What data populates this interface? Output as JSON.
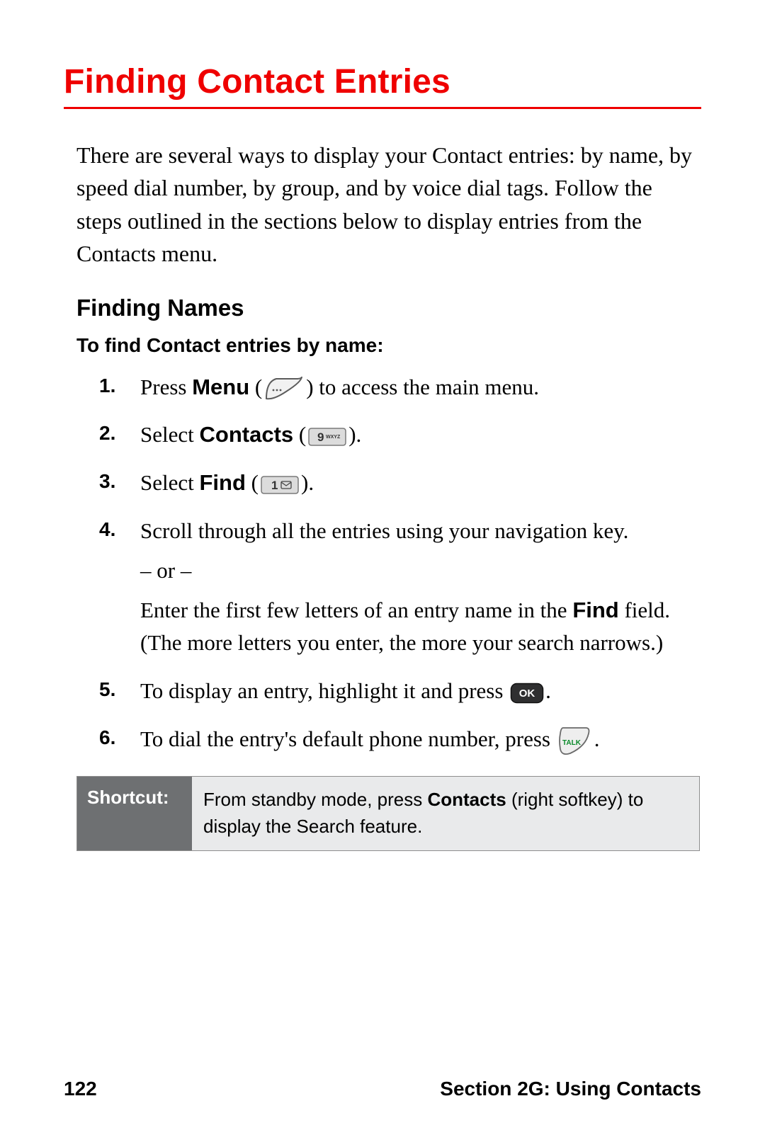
{
  "title": "Finding Contact Entries",
  "intro": "There are several ways to display your Contact entries: by name, by speed dial number, by group, and by voice dial tags. Follow the steps outlined in the sections below to display entries from the Contacts menu.",
  "subheading": "Finding Names",
  "lead": "To find Contact entries by name:",
  "steps": {
    "s1_a": "Press ",
    "s1_b": "Menu",
    "s1_c": " (",
    "s1_d": ") to access the main menu.",
    "s2_a": "Select ",
    "s2_b": "Contacts",
    "s2_c": " (",
    "s2_d": ").",
    "s3_a": "Select ",
    "s3_b": "Find",
    "s3_c": " (",
    "s3_d": ").",
    "s4": "Scroll through all the entries using your navigation key.",
    "s4_or": "– or –",
    "s4_b1": "Enter the first few letters of an entry name in the ",
    "s4_b2": "Find",
    "s4_b3": " field. (The more letters you enter, the more your search narrows.)",
    "s5_a": "To display an entry, highlight it and press ",
    "s5_b": ".",
    "s6_a": "To dial the entry's default phone number, press ",
    "s6_b": "."
  },
  "keys": {
    "key9": "9",
    "key9_sub": "WXYZ",
    "key1": "1",
    "ok": "OK",
    "talk": "TALK"
  },
  "shortcut": {
    "label": "Shortcut:",
    "t1": "From standby mode, press ",
    "t2": "Contacts",
    "t3": " (right softkey) to display the Search feature."
  },
  "footer": {
    "page": "122",
    "section": "Section 2G: Using Contacts"
  }
}
